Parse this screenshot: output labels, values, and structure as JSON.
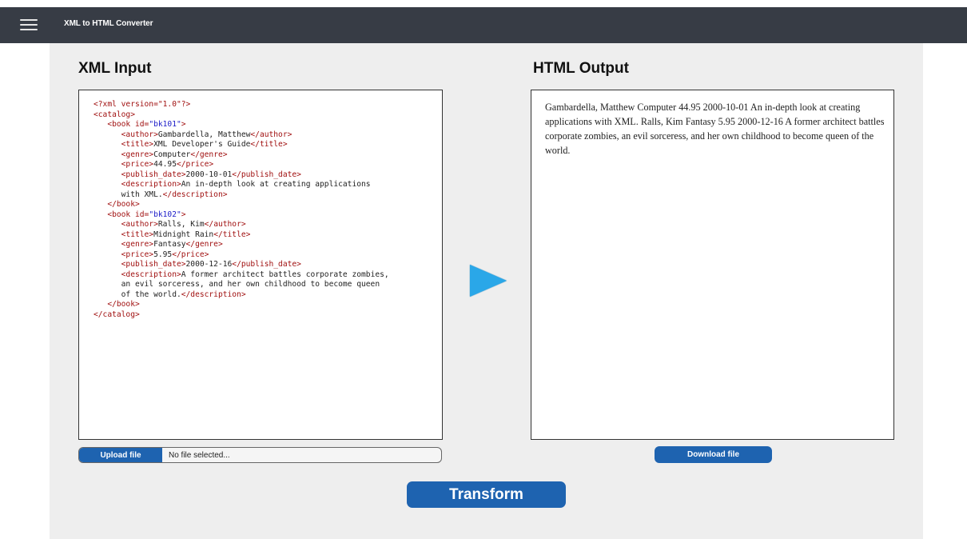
{
  "header": {
    "app_title": "XML to HTML Converter",
    "menu_icon": "hamburger-menu-icon"
  },
  "xml_panel": {
    "title": "XML Input",
    "lines": [
      [
        {
          "t": "t",
          "s": "<?xml version=\"1.0\"?>"
        }
      ],
      [
        {
          "t": "t",
          "s": "<catalog>"
        }
      ],
      [
        {
          "t": "p",
          "s": "   "
        },
        {
          "t": "t",
          "s": "<book id="
        },
        {
          "t": "v",
          "s": "\"bk101\""
        },
        {
          "t": "t",
          "s": ">"
        }
      ],
      [
        {
          "t": "p",
          "s": "      "
        },
        {
          "t": "t",
          "s": "<author>"
        },
        {
          "t": "p",
          "s": "Gambardella, Matthew"
        },
        {
          "t": "t",
          "s": "</author>"
        }
      ],
      [
        {
          "t": "p",
          "s": "      "
        },
        {
          "t": "t",
          "s": "<title>"
        },
        {
          "t": "p",
          "s": "XML Developer's Guide"
        },
        {
          "t": "t",
          "s": "</title>"
        }
      ],
      [
        {
          "t": "p",
          "s": "      "
        },
        {
          "t": "t",
          "s": "<genre>"
        },
        {
          "t": "p",
          "s": "Computer"
        },
        {
          "t": "t",
          "s": "</genre>"
        }
      ],
      [
        {
          "t": "p",
          "s": "      "
        },
        {
          "t": "t",
          "s": "<price>"
        },
        {
          "t": "p",
          "s": "44.95"
        },
        {
          "t": "t",
          "s": "</price>"
        }
      ],
      [
        {
          "t": "p",
          "s": "      "
        },
        {
          "t": "t",
          "s": "<publish_date>"
        },
        {
          "t": "p",
          "s": "2000-10-01"
        },
        {
          "t": "t",
          "s": "</publish_date>"
        }
      ],
      [
        {
          "t": "p",
          "s": "      "
        },
        {
          "t": "t",
          "s": "<description>"
        },
        {
          "t": "p",
          "s": "An in-depth look at creating applications"
        }
      ],
      [
        {
          "t": "p",
          "s": "      with XML."
        },
        {
          "t": "t",
          "s": "</description>"
        }
      ],
      [
        {
          "t": "p",
          "s": "   "
        },
        {
          "t": "t",
          "s": "</book>"
        }
      ],
      [
        {
          "t": "p",
          "s": "   "
        },
        {
          "t": "t",
          "s": "<book id="
        },
        {
          "t": "v",
          "s": "\"bk102\""
        },
        {
          "t": "t",
          "s": ">"
        }
      ],
      [
        {
          "t": "p",
          "s": "      "
        },
        {
          "t": "t",
          "s": "<author>"
        },
        {
          "t": "p",
          "s": "Ralls, Kim"
        },
        {
          "t": "t",
          "s": "</author>"
        }
      ],
      [
        {
          "t": "p",
          "s": "      "
        },
        {
          "t": "t",
          "s": "<title>"
        },
        {
          "t": "p",
          "s": "Midnight Rain"
        },
        {
          "t": "t",
          "s": "</title>"
        }
      ],
      [
        {
          "t": "p",
          "s": "      "
        },
        {
          "t": "t",
          "s": "<genre>"
        },
        {
          "t": "p",
          "s": "Fantasy"
        },
        {
          "t": "t",
          "s": "</genre>"
        }
      ],
      [
        {
          "t": "p",
          "s": "      "
        },
        {
          "t": "t",
          "s": "<price>"
        },
        {
          "t": "p",
          "s": "5.95"
        },
        {
          "t": "t",
          "s": "</price>"
        }
      ],
      [
        {
          "t": "p",
          "s": "      "
        },
        {
          "t": "t",
          "s": "<publish_date>"
        },
        {
          "t": "p",
          "s": "2000-12-16"
        },
        {
          "t": "t",
          "s": "</publish_date>"
        }
      ],
      [
        {
          "t": "p",
          "s": "      "
        },
        {
          "t": "t",
          "s": "<description>"
        },
        {
          "t": "p",
          "s": "A former architect battles corporate zombies,"
        }
      ],
      [
        {
          "t": "p",
          "s": "      an evil sorceress, and her own childhood to become queen"
        }
      ],
      [
        {
          "t": "p",
          "s": "      of the world."
        },
        {
          "t": "t",
          "s": "</description>"
        }
      ],
      [
        {
          "t": "p",
          "s": "   "
        },
        {
          "t": "t",
          "s": "</book>"
        }
      ],
      [
        {
          "t": "t",
          "s": "</catalog>"
        }
      ]
    ],
    "upload_label": "Upload file",
    "file_status": "No file selected..."
  },
  "html_panel": {
    "title": "HTML Output",
    "output": "Gambardella, Matthew Computer 44.95 2000-10-01 An in-depth look at creating applications with XML. Ralls, Kim Fantasy 5.95 2000-12-16 A former architect battles corporate zombies, an evil sorceress, and her own childhood to become queen of the world.",
    "download_label": "Download file"
  },
  "actions": {
    "transform_label": "Transform",
    "arrow_icon": "play-arrow-icon"
  },
  "colors": {
    "header_bg": "#373c45",
    "workspace_bg": "#eeeeee",
    "button_blue": "#1e63b0",
    "arrow_blue": "#2aa7e8",
    "tag_red": "#a01010",
    "attr_value_blue": "#1a1ac8"
  }
}
